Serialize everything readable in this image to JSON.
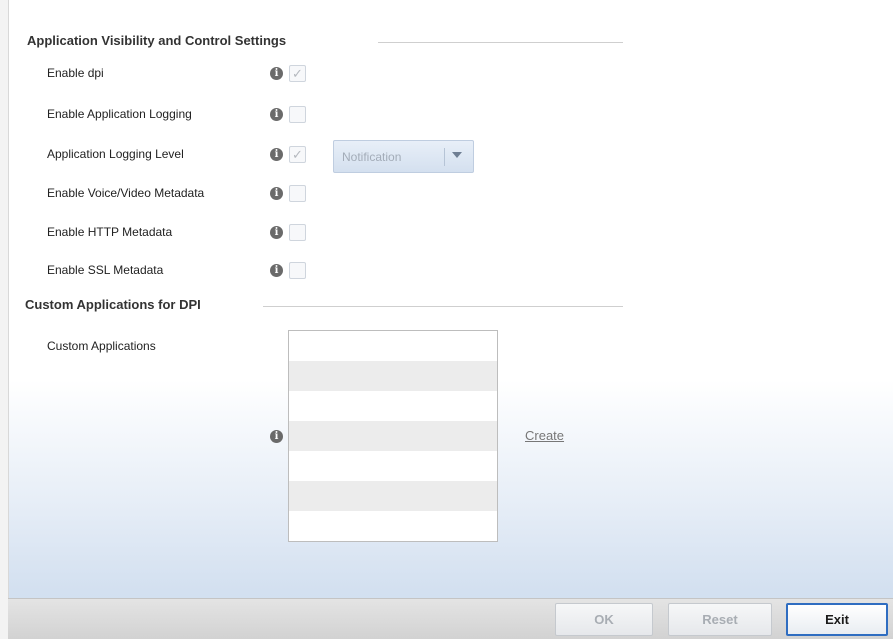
{
  "sections": {
    "avc_title": "Application Visibility and Control Settings",
    "custom_title": "Custom Applications for DPI"
  },
  "fields": [
    {
      "label": "Enable dpi",
      "checked": true
    },
    {
      "label": "Enable Application Logging",
      "checked": false
    },
    {
      "label": "Application Logging Level",
      "checked": true
    },
    {
      "label": "Enable Voice/Video Metadata",
      "checked": false
    },
    {
      "label": "Enable HTTP Metadata",
      "checked": false
    },
    {
      "label": "Enable SSL Metadata",
      "checked": false
    }
  ],
  "logging_level": {
    "value": "Notification"
  },
  "custom_apps": {
    "label": "Custom Applications",
    "create_label": "Create",
    "rows": [
      "",
      "",
      "",
      "",
      "",
      "",
      ""
    ]
  },
  "icons": {
    "info": "i",
    "check": "✓"
  },
  "footer": {
    "ok_label": "OK",
    "reset_label": "Reset",
    "exit_label": "Exit"
  },
  "colors": {
    "accent": "#2f6dc1",
    "link": "#777777"
  }
}
